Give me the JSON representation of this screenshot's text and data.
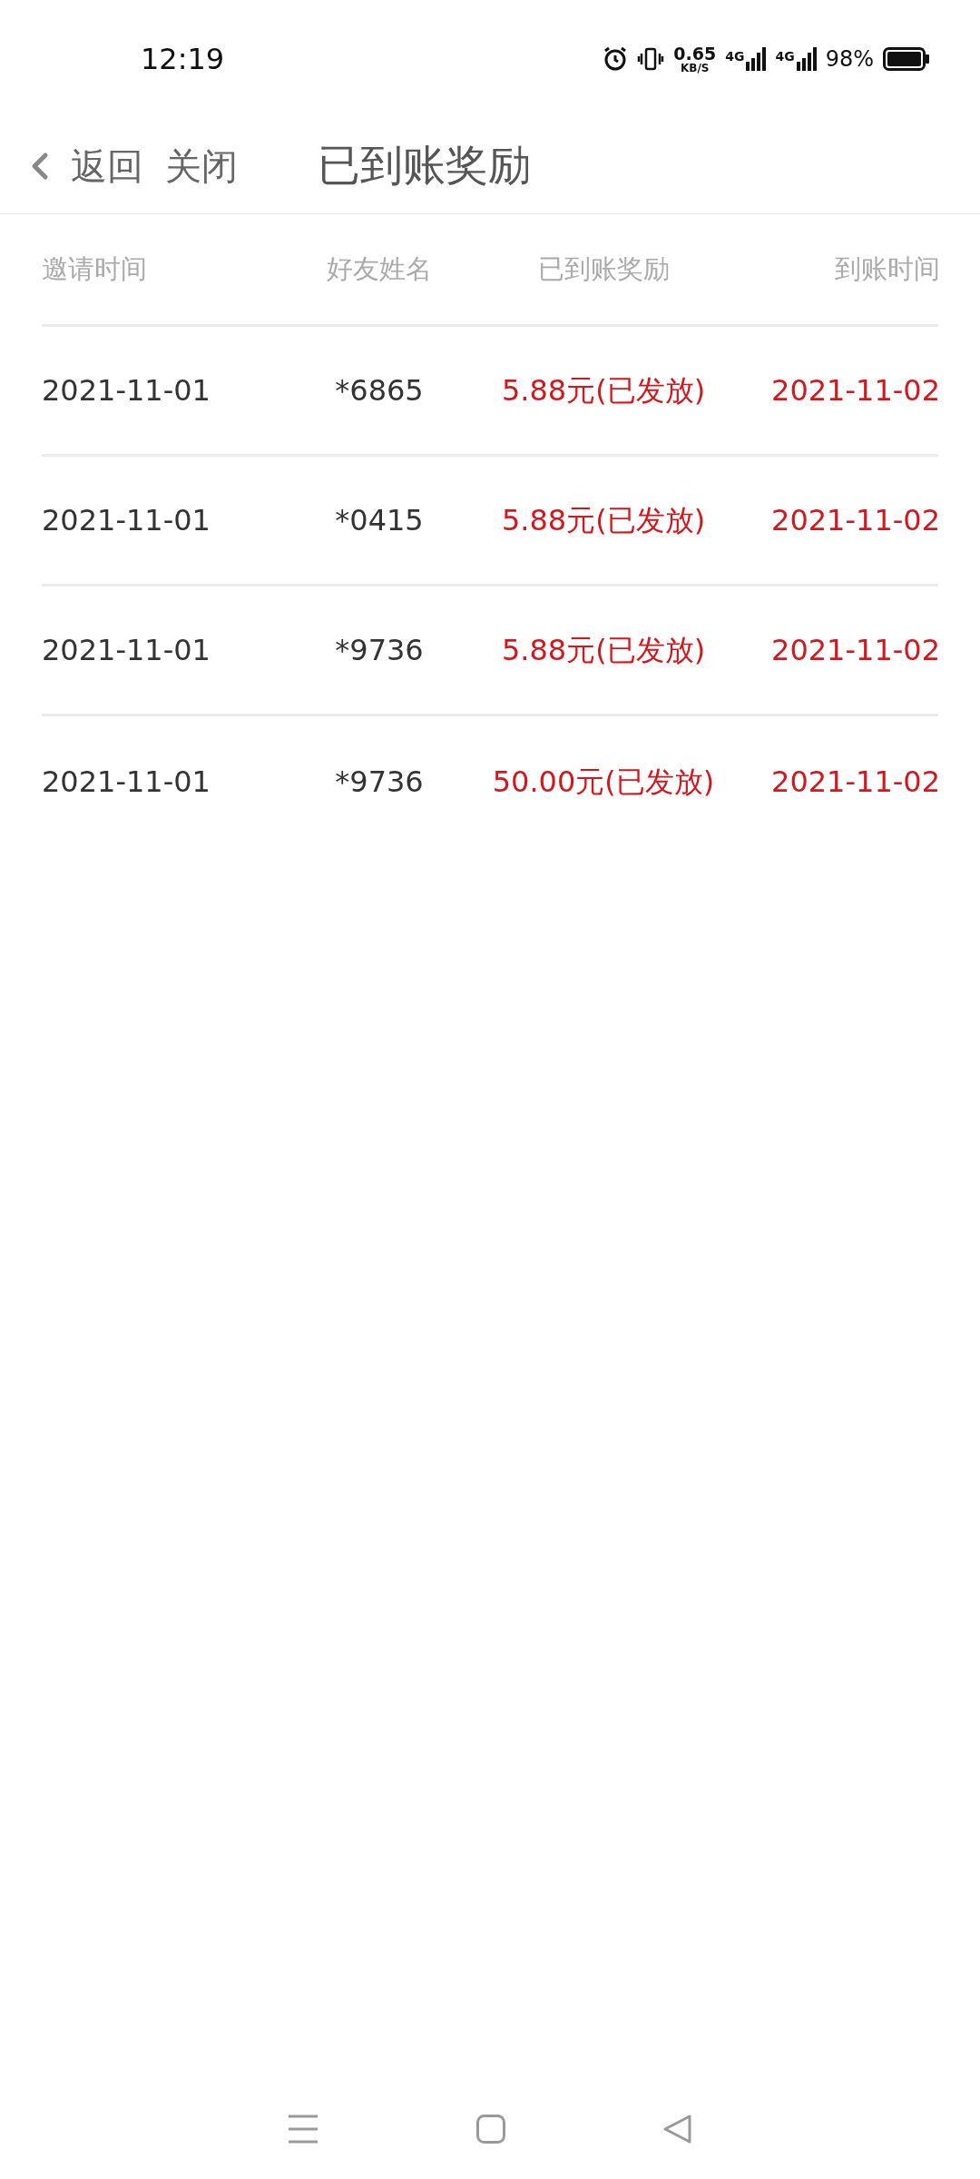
{
  "status_bar": {
    "time": "12:19",
    "net_speed": "0.65",
    "net_unit": "KB/S",
    "sim1": "4G",
    "sim2": "4G",
    "battery": "98%"
  },
  "header": {
    "back": "返回",
    "close": "关闭",
    "title": "已到账奖励"
  },
  "table": {
    "columns": [
      "邀请时间",
      "好友姓名",
      "已到账奖励",
      "到账时间"
    ],
    "rows": [
      [
        "2021-11-01",
        "*6865",
        "5.88元(已发放)",
        "2021-11-02"
      ],
      [
        "2021-11-01",
        "*0415",
        "5.88元(已发放)",
        "2021-11-02"
      ],
      [
        "2021-11-01",
        "*9736",
        "5.88元(已发放)",
        "2021-11-02"
      ],
      [
        "2021-11-01",
        "*9736",
        "50.00元(已发放)",
        "2021-11-02"
      ]
    ]
  }
}
